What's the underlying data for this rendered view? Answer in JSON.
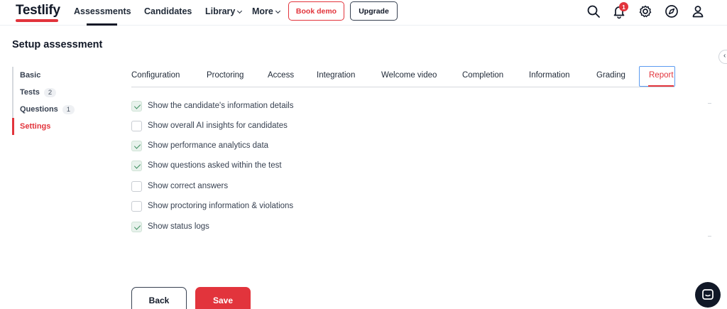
{
  "header": {
    "logo": "Testlify",
    "nav": [
      {
        "label": "Assessments",
        "active": true
      },
      {
        "label": "Candidates"
      },
      {
        "label": "Library",
        "dropdown": true
      },
      {
        "label": "More",
        "dropdown": true
      }
    ],
    "book_demo_label": "Book demo",
    "upgrade_label": "Upgrade",
    "notification_count": "1",
    "icons": [
      "search-icon",
      "bell-icon",
      "gear-icon",
      "compass-icon",
      "user-icon"
    ]
  },
  "page": {
    "title": "Setup assessment"
  },
  "sidebar": {
    "items": [
      {
        "label": "Basic",
        "count": ""
      },
      {
        "label": "Tests",
        "count": "2"
      },
      {
        "label": "Questions",
        "count": "1"
      },
      {
        "label": "Settings",
        "count": "",
        "active": true
      }
    ]
  },
  "tabs": [
    {
      "label": "Configuration"
    },
    {
      "label": "Proctoring"
    },
    {
      "label": "Access"
    },
    {
      "label": "Integration"
    },
    {
      "label": "Welcome video"
    },
    {
      "label": "Completion"
    },
    {
      "label": "Information"
    },
    {
      "label": "Grading"
    },
    {
      "label": "Report",
      "active": true
    }
  ],
  "options": [
    {
      "label": "Show the candidate's information details",
      "checked": true
    },
    {
      "label": "Show overall AI insights for candidates",
      "checked": false
    },
    {
      "label": "Show performance analytics data",
      "checked": true
    },
    {
      "label": "Show questions asked within the test",
      "checked": true
    },
    {
      "label": "Show correct answers",
      "checked": false
    },
    {
      "label": "Show proctoring information & violations",
      "checked": false
    },
    {
      "label": "Show status logs",
      "checked": true
    }
  ],
  "actions": {
    "back_label": "Back",
    "save_label": "Save"
  },
  "colors": {
    "brand": "#e2343c",
    "check": "#3e8f60",
    "focus": "#5b9bf0"
  }
}
